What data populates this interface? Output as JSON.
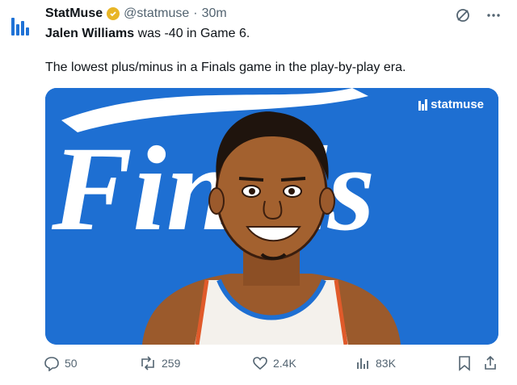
{
  "account": {
    "name": "StatMuse",
    "handle": "@statmuse",
    "separator": "·",
    "time": "30m"
  },
  "tweet": {
    "mention": "Jalen Williams",
    "line1_rest": " was -40 in Game 6.",
    "line2": "The lowest plus/minus in a Finals game in the play-by-play era."
  },
  "media": {
    "background_word": "Finals",
    "brand": "statmuse"
  },
  "actions": {
    "replies": "50",
    "reposts": "259",
    "likes": "2.4K",
    "views": "83K"
  },
  "icons": {
    "verified": "verified-badge-icon",
    "grok": "grok-icon",
    "more": "more-icon",
    "reply": "reply-icon",
    "repost": "repost-icon",
    "like": "like-icon",
    "views": "views-icon",
    "bookmark": "bookmark-icon",
    "share": "share-icon"
  },
  "colors": {
    "media_bg": "#1e6fd2",
    "verified": "#e8b526",
    "secondary_text": "#536471"
  }
}
